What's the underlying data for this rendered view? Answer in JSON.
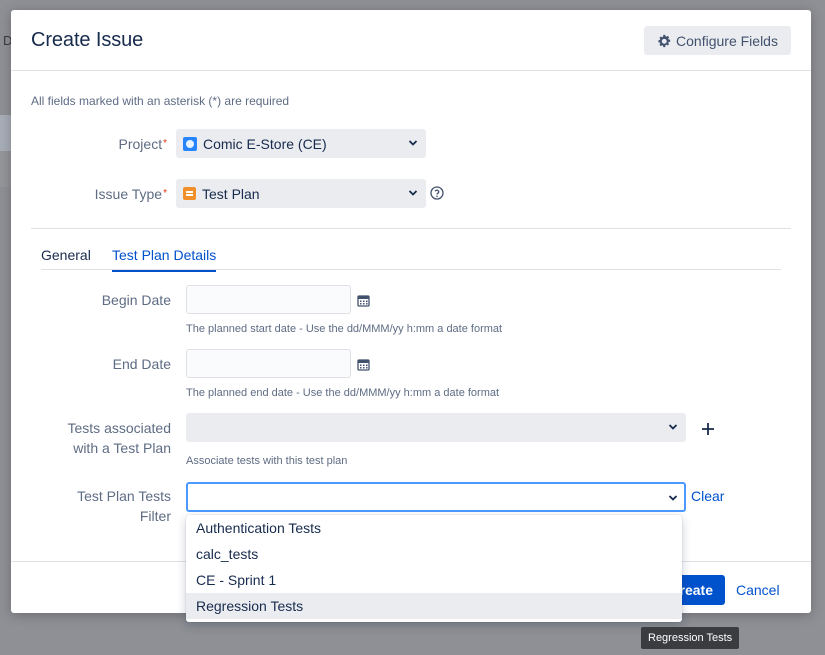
{
  "background": {
    "letter": "D"
  },
  "modal": {
    "title": "Create Issue",
    "configure_fields_label": "Configure Fields",
    "required_note": "All fields marked with an asterisk (*) are required"
  },
  "project": {
    "label": "Project",
    "required_marker": "*",
    "value": "Comic E-Store (CE)"
  },
  "issue_type": {
    "label": "Issue Type",
    "required_marker": "*",
    "value": "Test Plan"
  },
  "tabs": [
    {
      "label": "General",
      "active": false
    },
    {
      "label": "Test Plan Details",
      "active": true
    }
  ],
  "begin_date": {
    "label": "Begin Date",
    "value": "",
    "description": "The planned start date - Use the dd/MMM/yy h:mm a date format"
  },
  "end_date": {
    "label": "End Date",
    "value": "",
    "description": "The planned end date - Use the dd/MMM/yy h:mm a date format"
  },
  "tests_associated": {
    "label_line1": "Tests associated",
    "label_line2": "with a Test Plan",
    "value": "",
    "description": "Associate tests with this test plan"
  },
  "test_plan_filter": {
    "label_line1": "Test Plan Tests",
    "label_line2": "Filter",
    "value": "",
    "clear_label": "Clear",
    "options": [
      "Authentication Tests",
      "calc_tests",
      "CE - Sprint 1",
      "Regression Tests"
    ],
    "hovered_option": "Regression Tests"
  },
  "footer": {
    "create_label": "Create",
    "create_visible_text": "reate",
    "cancel_label": "Cancel"
  },
  "tooltip": {
    "text": "Regression Tests"
  },
  "colors": {
    "primary": "#0052cc",
    "focus_border": "#4c9aff",
    "required": "#de350b",
    "overlay": "#8f9095"
  }
}
